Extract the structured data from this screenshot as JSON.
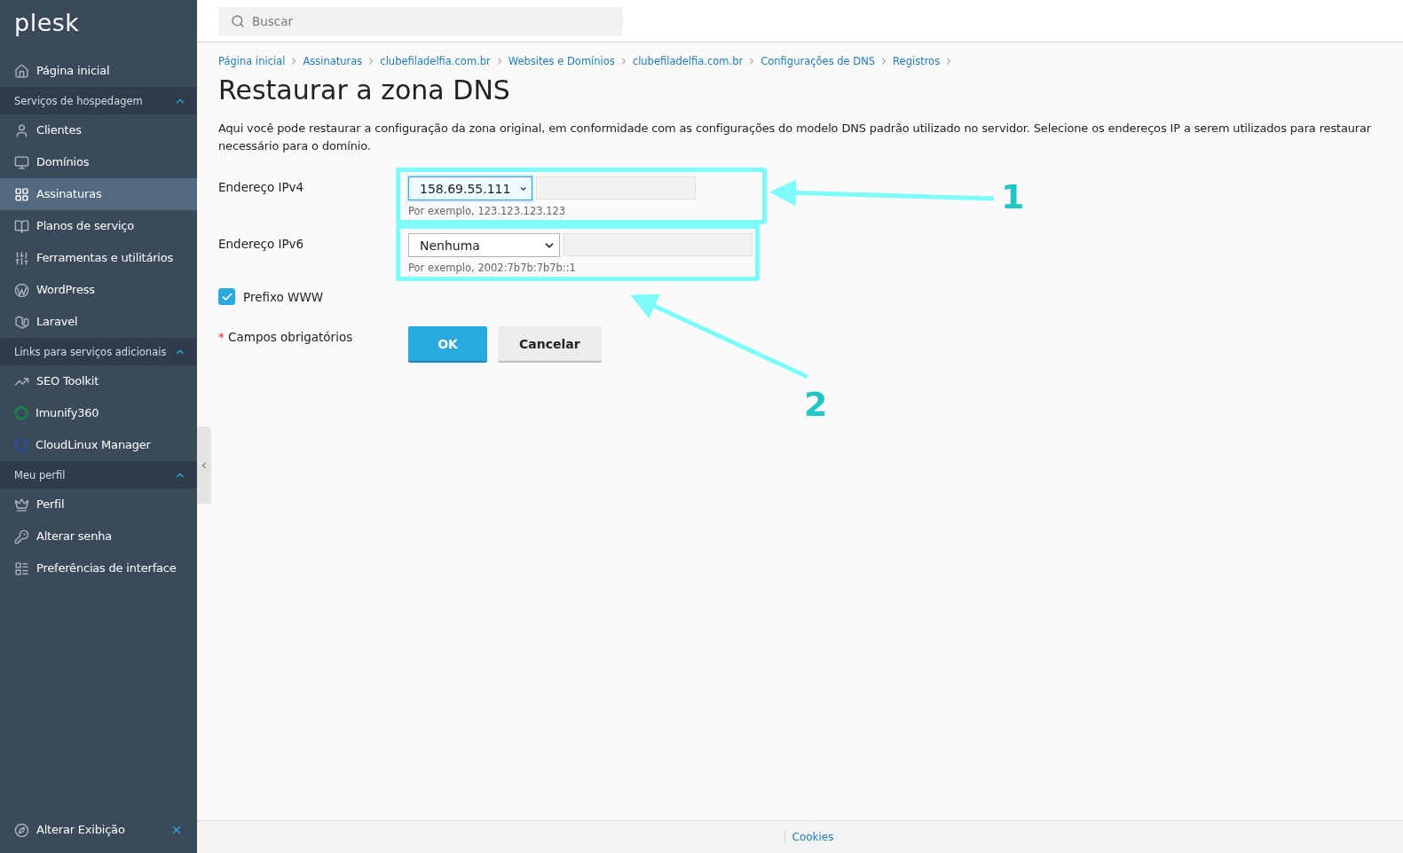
{
  "logo": "plesk",
  "sidebar": {
    "top_item": {
      "label": "Página inicial",
      "selected": false
    },
    "sections": [
      {
        "title": "Serviços de hospedagem",
        "expanded": true,
        "items": [
          {
            "label": "Clientes",
            "selected": false
          },
          {
            "label": "Domínios",
            "selected": false
          },
          {
            "label": "Assinaturas",
            "selected": true
          },
          {
            "label": "Planos de serviço",
            "selected": false
          },
          {
            "label": "Ferramentas e utilitários",
            "selected": false
          },
          {
            "label": "WordPress",
            "selected": false
          },
          {
            "label": "Laravel",
            "selected": false
          }
        ]
      },
      {
        "title": "Links para serviços adicionais",
        "expanded": true,
        "items": [
          {
            "label": "SEO Toolkit",
            "selected": false
          },
          {
            "label": "Imunify360",
            "selected": false
          },
          {
            "label": "CloudLinux Manager",
            "selected": false
          }
        ]
      },
      {
        "title": "Meu perfil",
        "expanded": true,
        "items": [
          {
            "label": "Perfil",
            "selected": false
          },
          {
            "label": "Alterar senha",
            "selected": false
          },
          {
            "label": "Preferências de interface",
            "selected": false
          }
        ]
      }
    ],
    "footer_item": "Alterar Exibição"
  },
  "search": {
    "placeholder": "Buscar"
  },
  "breadcrumbs": [
    "Página inicial",
    "Assinaturas",
    "clubefiladelfia.com.br",
    "Websites e Domínios",
    "clubefiladelfia.com.br",
    "Configurações de DNS",
    "Registros"
  ],
  "title": "Restaurar a zona DNS",
  "description": [
    "Aqui você pode restaurar a configuração da zona original, em conformidade com as configurações do modelo DNS padrão utilizado no servidor. Selecione os endereços IP a serem utilizados para restaurar",
    "necessário para o domínio."
  ],
  "fields": [
    {
      "label": "Endereço IPv4",
      "value": "158.69.55.111",
      "focused": true,
      "hint": "Por exemplo, 123.123.123.123",
      "annotation": "1"
    },
    {
      "label": "Endereço IPv6",
      "value": "Nenhuma",
      "focused": false,
      "hint": "Por exemplo, 2002:7b7b:7b7b::1",
      "annotation": "2"
    }
  ],
  "checkbox": {
    "label": "Prefixo WWW",
    "checked": true
  },
  "required_note": {
    "mark": "*",
    "label": "Campos obrigatórios"
  },
  "buttons": [
    {
      "label": "OK",
      "kind": "primary"
    },
    {
      "label": "Cancelar",
      "kind": "secondary"
    }
  ],
  "footer": {
    "link": "Cookies"
  }
}
